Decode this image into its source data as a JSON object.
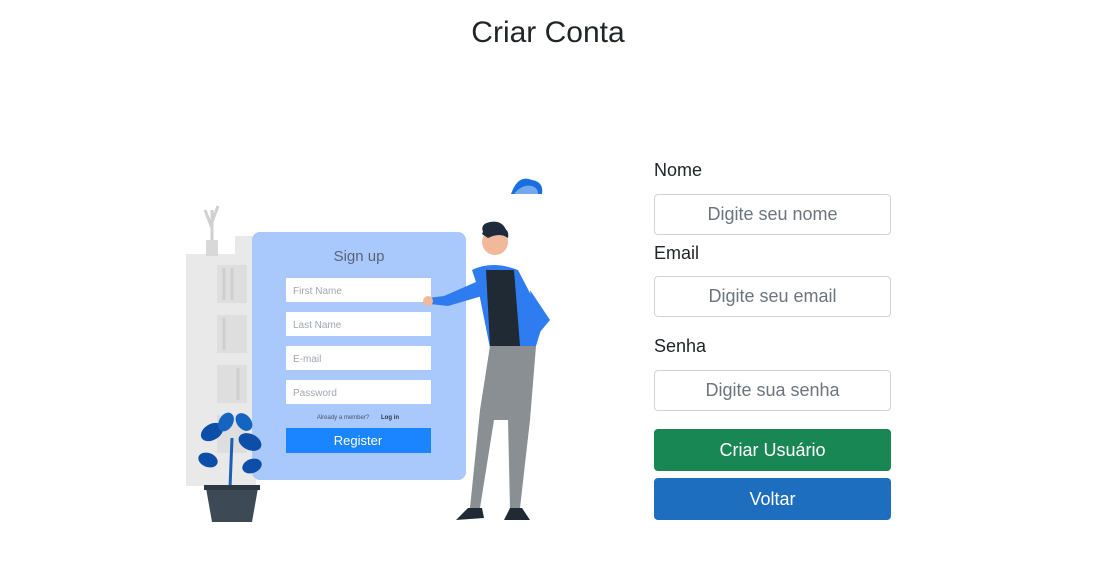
{
  "page": {
    "title": "Criar Conta"
  },
  "illustration": {
    "card_title": "Sign up",
    "fields": [
      "First Name",
      "Last Name",
      "E-mail",
      "Password"
    ],
    "member_text": "Already a member?",
    "login_link": "Log in",
    "register_label": "Register"
  },
  "form": {
    "name_label": "Nome",
    "name_placeholder": "Digite seu nome",
    "email_label": "Email",
    "email_placeholder": "Digite seu email",
    "password_label": "Senha",
    "password_placeholder": "Digite sua senha",
    "create_button": "Criar Usuário",
    "back_button": "Voltar"
  },
  "colors": {
    "success": "#198754",
    "primary": "#1e6ec0",
    "illustration_card": "#a9c8fb",
    "illustration_button": "#1a85ff"
  }
}
